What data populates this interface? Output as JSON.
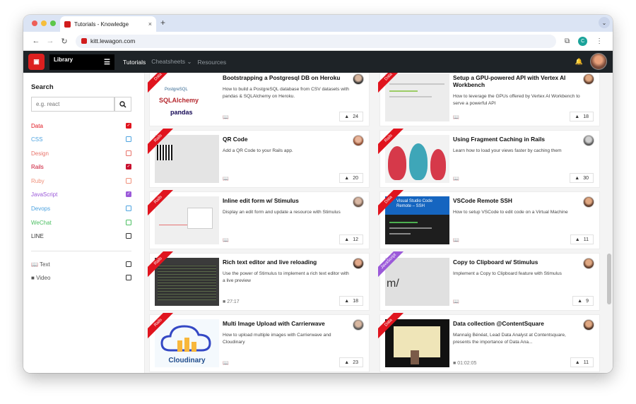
{
  "browser": {
    "tab_title": "Tutorials - Knowledge",
    "tab_close": "×",
    "new_tab": "+",
    "tab_dropdown": "⌄",
    "url": "kitt.lewagon.com",
    "profile_initial": "C"
  },
  "navbar": {
    "library_label": "Library",
    "links": [
      {
        "label": "Tutorials"
      },
      {
        "label": "Cheatsheets ⌄"
      },
      {
        "label": "Resources"
      }
    ]
  },
  "sidebar": {
    "title": "Search",
    "search_placeholder": "e.g. react",
    "filters": [
      {
        "label": "Data",
        "color": "#e0141e",
        "checked": true
      },
      {
        "label": "CSS",
        "color": "#4da3e0",
        "checked": false
      },
      {
        "label": "Design",
        "color": "#e8736a",
        "checked": false
      },
      {
        "label": "Rails",
        "color": "#c8102e",
        "checked": true
      },
      {
        "label": "Ruby",
        "color": "#f0907a",
        "checked": false
      },
      {
        "label": "JavaScript",
        "color": "#9b59d9",
        "checked": true
      },
      {
        "label": "Devops",
        "color": "#4da3e0",
        "checked": false
      },
      {
        "label": "WeChat",
        "color": "#4cbf62",
        "checked": false
      },
      {
        "label": "LINE",
        "color": "#333333",
        "checked": false
      }
    ],
    "media": [
      {
        "label": "Text"
      },
      {
        "label": "Video"
      }
    ]
  },
  "cards": [
    {
      "tag": "Data",
      "title": "Bootstrapping a Postgresql DB on Heroku",
      "desc": "How to build a PostgreSQL database from CSV datasets with pandas & SQLAlchemy on Heroku.",
      "upvotes": "24",
      "thumb_text": [
        "PostgreSQL",
        "SQLAlchemy",
        "pandas"
      ],
      "type": "text"
    },
    {
      "tag": "Data",
      "title": "Setup a GPU-powered API with Vertex AI Workbench",
      "desc": "How to leverage the GPUs offered by Vertex AI Workbench to serve a powerful API",
      "upvotes": "18",
      "type": "text"
    },
    {
      "tag": "Rails",
      "title": "QR Code",
      "desc": "Add a QR Code to your Rails app.",
      "upvotes": "20",
      "type": "text"
    },
    {
      "tag": "Rails",
      "title": "Using Fragment Caching in Rails",
      "desc": "Learn how to load your views faster by caching them",
      "upvotes": "30",
      "type": "text"
    },
    {
      "tag": "Rails",
      "title": "Inline edit form w/ Stimulus",
      "desc": "Display an edit form and update a resource with Stimulus",
      "upvotes": "12",
      "type": "text"
    },
    {
      "tag": "Data",
      "title": "VSCode Remote SSH",
      "desc": "How to setup VSCode to edit code on a Virtual Machine",
      "upvotes": "11",
      "thumb_text": [
        "Visual Studio Code",
        "Remote – SSH"
      ],
      "type": "text"
    },
    {
      "tag": "Rails",
      "title": "Rich text editor and live reloading",
      "desc": "Use the power of Stimulus to implement a rich text editor with a live preview",
      "upvotes": "18",
      "duration": "27:17",
      "type": "video"
    },
    {
      "tag": "JavaScript",
      "title": "Copy to Clipboard w/ Stimulus",
      "desc": "Implement a Copy to Clipboard feature with Stimulus",
      "upvotes": "9",
      "thumb_text": [
        "m/"
      ],
      "type": "text"
    },
    {
      "tag": "Rails",
      "title": "Multi Image Upload with Carrierwave",
      "desc": "How to upload multiple images with Carrierwave and Cloudinary",
      "upvotes": "23",
      "thumb_text": [
        "Cloudinary"
      ],
      "type": "text"
    },
    {
      "tag": "Data",
      "title": "Data collection @ContentSquare",
      "desc": "Mannaïg Bénéat, Lead Data Analyst at Contentsquare, presents the importance of Data Ana...",
      "upvotes": "11",
      "duration": "01:02:05",
      "type": "video"
    }
  ],
  "colors": {
    "navbar_bg": "#1e2327",
    "brand_red": "#dc1f1f",
    "tag_data": "#e0141e",
    "tag_js": "#9b59d9"
  }
}
